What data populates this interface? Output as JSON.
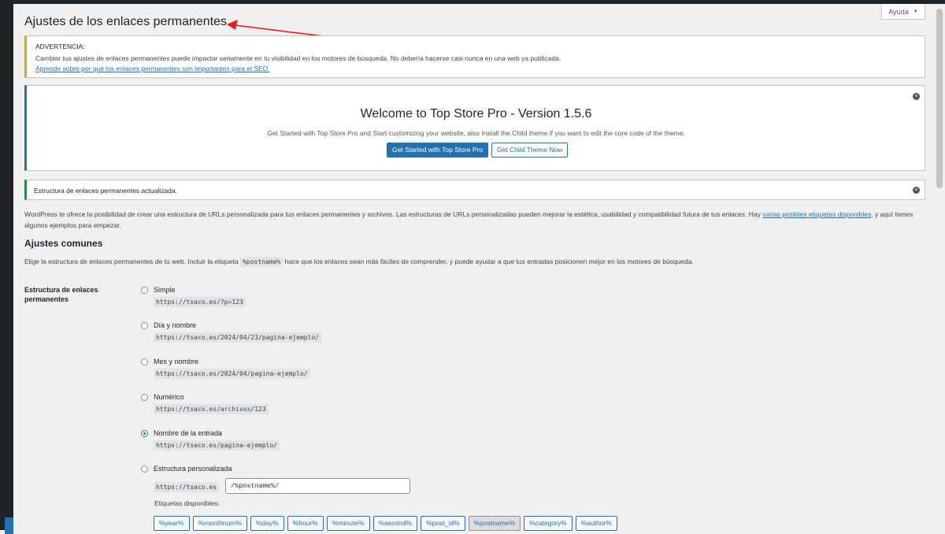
{
  "help_tab": {
    "label": "Ayuda",
    "chevron": "▼"
  },
  "page_title": "Ajustes de los enlaces permanentes",
  "warning": {
    "title": "ADVERTENCIA:",
    "text_before": "Cambiar tus ajustes de enlaces permanentes puede impactar seriamente en tu visibilidad en los motores de búsqueda. No debería hacerse casi ",
    "text_emphasis": "nunca",
    "text_after": " en una web ya publicada.",
    "link": "Aprende sobre por qué los enlaces permanentes son importantes para el SEO."
  },
  "welcome": {
    "heading": "Welcome to Top Store Pro - Version 1.5.6",
    "description": "Get Started with Top Store Pro and Start customizing your website, also Install the Child theme if you want to edit the core code of the theme.",
    "primary_button": "Get Started with Top Store Pro",
    "secondary_button": "Get Child Theme Now"
  },
  "success_notice": "Estructura de enlaces permanentes actualizada.",
  "intro": {
    "text_before": "WordPress te ofrece la posibilidad de crear una estructura de URLs personalizada para tus enlaces permanentes y archivos. Las estructuras de URLs personalizadas pueden mejorar la estética, usabilidad y compatibilidad futura de tus enlaces. Hay ",
    "link": "varias posibles etiquetas disponibles",
    "text_after": ", y aquí tienes algunos ejemplos para empezar."
  },
  "section": {
    "title": "Ajustes comunes",
    "desc_before": "Elige la estructura de enlaces permanentes de tu web. Incluir la etiqueta ",
    "desc_code": "%postname%",
    "desc_after": " hace que los enlaces sean más fáciles de comprender, y puede ayudar a que tus entradas posicionen mejor en los motores de búsqueda."
  },
  "field_label": "Estructura de enlaces permanentes",
  "options": [
    {
      "label": "Simple",
      "example": "https://tsaco.es/?p=123",
      "checked": false
    },
    {
      "label": "Día y nombre",
      "example": "https://tsaco.es/2024/04/23/pagina-ejemplo/",
      "checked": false
    },
    {
      "label": "Mes y nombre",
      "example": "https://tsaco.es/2024/04/pagina-ejemplo/",
      "checked": false
    },
    {
      "label": "Numérico",
      "example": "https://tsaco.es/archivos/123",
      "checked": false
    },
    {
      "label": "Nombre de la entrada",
      "example": "https://tsaco.es/pagina-ejemplo/",
      "checked": true
    },
    {
      "label": "Estructura personalizada",
      "example": "https://tsaco.es",
      "checked": false
    }
  ],
  "custom_structure_value": "/%postname%/",
  "tags_label": "Etiquetas disponibles:",
  "tags": [
    "%year%",
    "%monthnum%",
    "%day%",
    "%hour%",
    "%minute%",
    "%second%",
    "%post_id%",
    "%postname%",
    "%category%",
    "%author%"
  ],
  "active_tag": "%postname%",
  "colors": {
    "accent": "#2271b1",
    "warning": "#dba617",
    "success": "#00a32a",
    "annotation_arrow": "#e02020"
  }
}
